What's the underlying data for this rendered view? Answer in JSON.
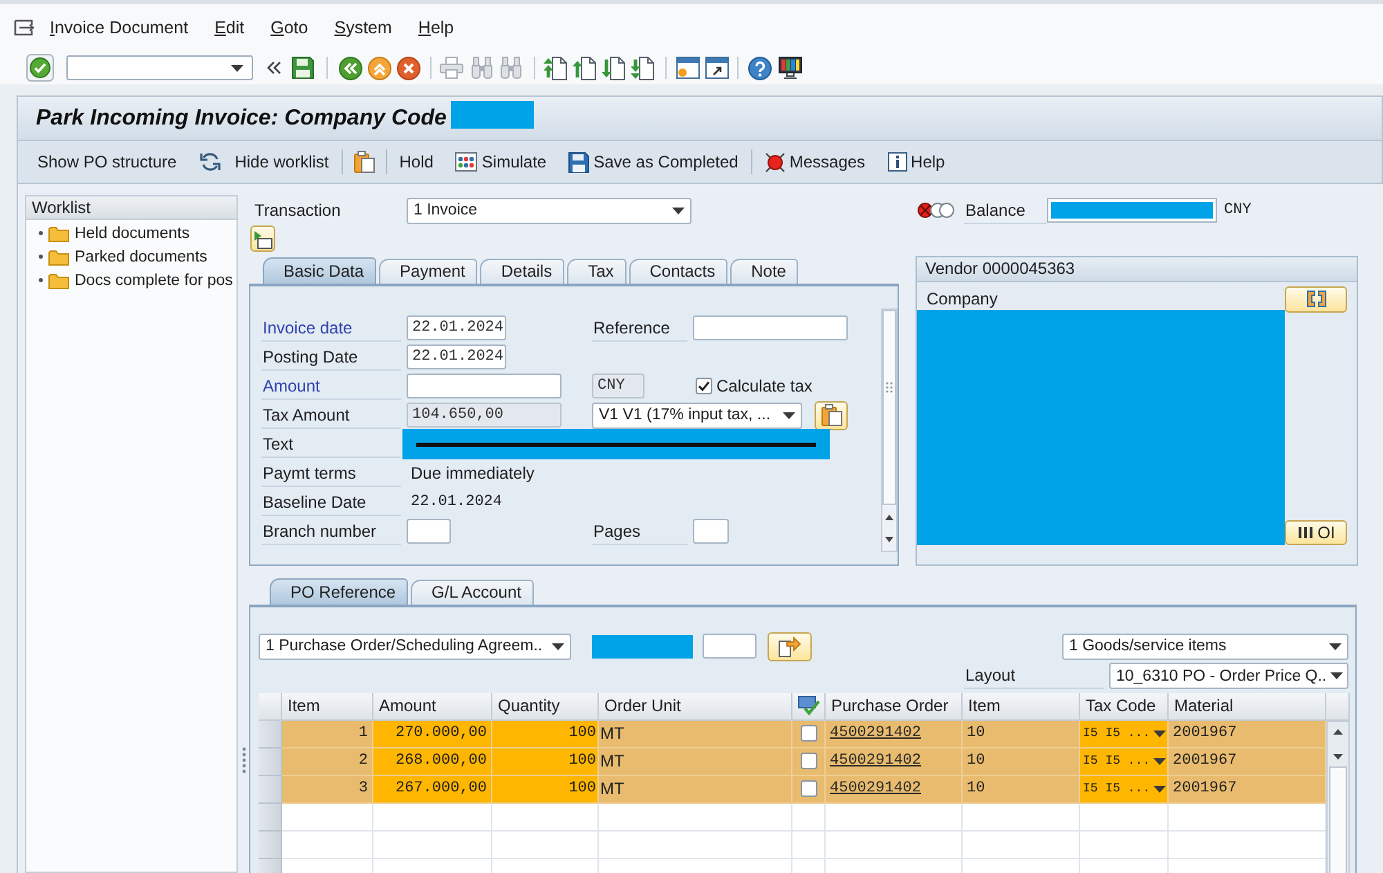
{
  "menu_bar": {
    "items": [
      "Invoice Document",
      "Edit",
      "Goto",
      "System",
      "Help"
    ]
  },
  "toolbar": {
    "print": {
      "disabled": true
    },
    "find": {
      "disabled": true
    },
    "find_next": {
      "disabled": true
    }
  },
  "title": "Park Incoming Invoice: Company Code",
  "app_toolbar": {
    "groups": [
      [
        {
          "kind": "text",
          "label": "Show PO structure"
        },
        {
          "kind": "icon-text",
          "label": "Hide worklist"
        }
      ],
      [
        {
          "kind": "icon"
        }
      ],
      [
        {
          "kind": "text",
          "label": "Hold"
        },
        {
          "kind": "icon-text",
          "label": "Simulate"
        },
        {
          "kind": "icon-text",
          "label": "Save as Completed"
        }
      ],
      [
        {
          "kind": "icon-text",
          "label": "Messages"
        },
        {
          "kind": "icon-text",
          "label": "Help"
        }
      ]
    ]
  },
  "worklist": {
    "title": "Worklist",
    "items": [
      {
        "label": "Held documents"
      },
      {
        "label": "Parked documents"
      },
      {
        "label": "Docs complete for pos"
      }
    ]
  },
  "header": {
    "transaction": {
      "label": "Transaction",
      "value": "1 Invoice"
    },
    "balance": {
      "label": "Balance",
      "currency": "CNY"
    }
  },
  "basic_tabs": [
    {
      "label": "Basic Data",
      "selected": true
    },
    {
      "label": "Payment",
      "selected": false
    },
    {
      "label": "Details",
      "selected": false
    },
    {
      "label": "Tax",
      "selected": false
    },
    {
      "label": "Contacts",
      "selected": false
    },
    {
      "label": "Note",
      "selected": false
    }
  ],
  "basic_data": {
    "invoice_date": {
      "label": "Invoice date",
      "required": true,
      "value": "22.01.2024",
      "read_only": false
    },
    "reference": {
      "label": "Reference",
      "required": false,
      "read_only": false
    },
    "posting_date": {
      "label": "Posting Date",
      "required": false,
      "value": "22.01.2024",
      "read_only": false
    },
    "amount": {
      "label": "Amount",
      "required": true,
      "read_only": false
    },
    "currency": {
      "value": "CNY",
      "read_only": true
    },
    "calculate_tax": {
      "label": "Calculate tax",
      "checked": true
    },
    "tax_amount": {
      "label": "Tax Amount",
      "required": false,
      "value": "104.650,00",
      "read_only": true
    },
    "tax_code": {
      "value": "V1 V1 (17% input tax, ..."
    },
    "text": {
      "label": "Text",
      "required": false
    },
    "payment_terms": {
      "label": "Paymt terms",
      "required": false,
      "value": "Due immediately"
    },
    "baseline_date": {
      "label": "Baseline Date",
      "required": false,
      "value": "22.01.2024"
    },
    "branch_number": {
      "label": "Branch number",
      "required": false,
      "read_only": false
    },
    "pages": {
      "label": "Pages",
      "required": false,
      "read_only": false
    }
  },
  "vendor": {
    "title": "Vendor 0000045363",
    "company_label": "Company",
    "oi_button": "OI"
  },
  "lower_tabs": [
    {
      "label": "PO Reference",
      "selected": true
    },
    {
      "label": "G/L Account",
      "selected": false
    }
  ],
  "po_reference": {
    "reference_type": "1 Purchase Order/Scheduling Agreem..",
    "item_filter": "1 Goods/service items",
    "layout": {
      "label": "Layout",
      "value": "10_6310 PO - Order Price Q.."
    },
    "table": {
      "columns": [
        {
          "kind": "text",
          "label": "Item"
        },
        {
          "kind": "text",
          "label": "Amount"
        },
        {
          "kind": "text",
          "label": "Quantity"
        },
        {
          "kind": "text",
          "label": "Order Unit"
        },
        {
          "kind": "icon"
        },
        {
          "kind": "text",
          "label": "Purchase Order"
        },
        {
          "kind": "text",
          "label": "Item"
        },
        {
          "kind": "text",
          "label": "Tax Code"
        },
        {
          "kind": "text",
          "label": "Material"
        }
      ],
      "rows": [
        {
          "item": "1",
          "amount": "270.000,00",
          "quantity": "100",
          "order_unit": "MT",
          "checked": false,
          "purchase_order": "4500291402",
          "po_item": "10",
          "tax_code": "I5 I5 ...",
          "material": "2001967"
        },
        {
          "item": "2",
          "amount": "268.000,00",
          "quantity": "100",
          "order_unit": "MT",
          "checked": false,
          "purchase_order": "4500291402",
          "po_item": "10",
          "tax_code": "I5 I5 ...",
          "material": "2001967"
        },
        {
          "item": "3",
          "amount": "267.000,00",
          "quantity": "100",
          "order_unit": "MT",
          "checked": false,
          "purchase_order": "4500291402",
          "po_item": "10",
          "tax_code": "I5 I5 ...",
          "material": "2001967"
        }
      ]
    }
  }
}
